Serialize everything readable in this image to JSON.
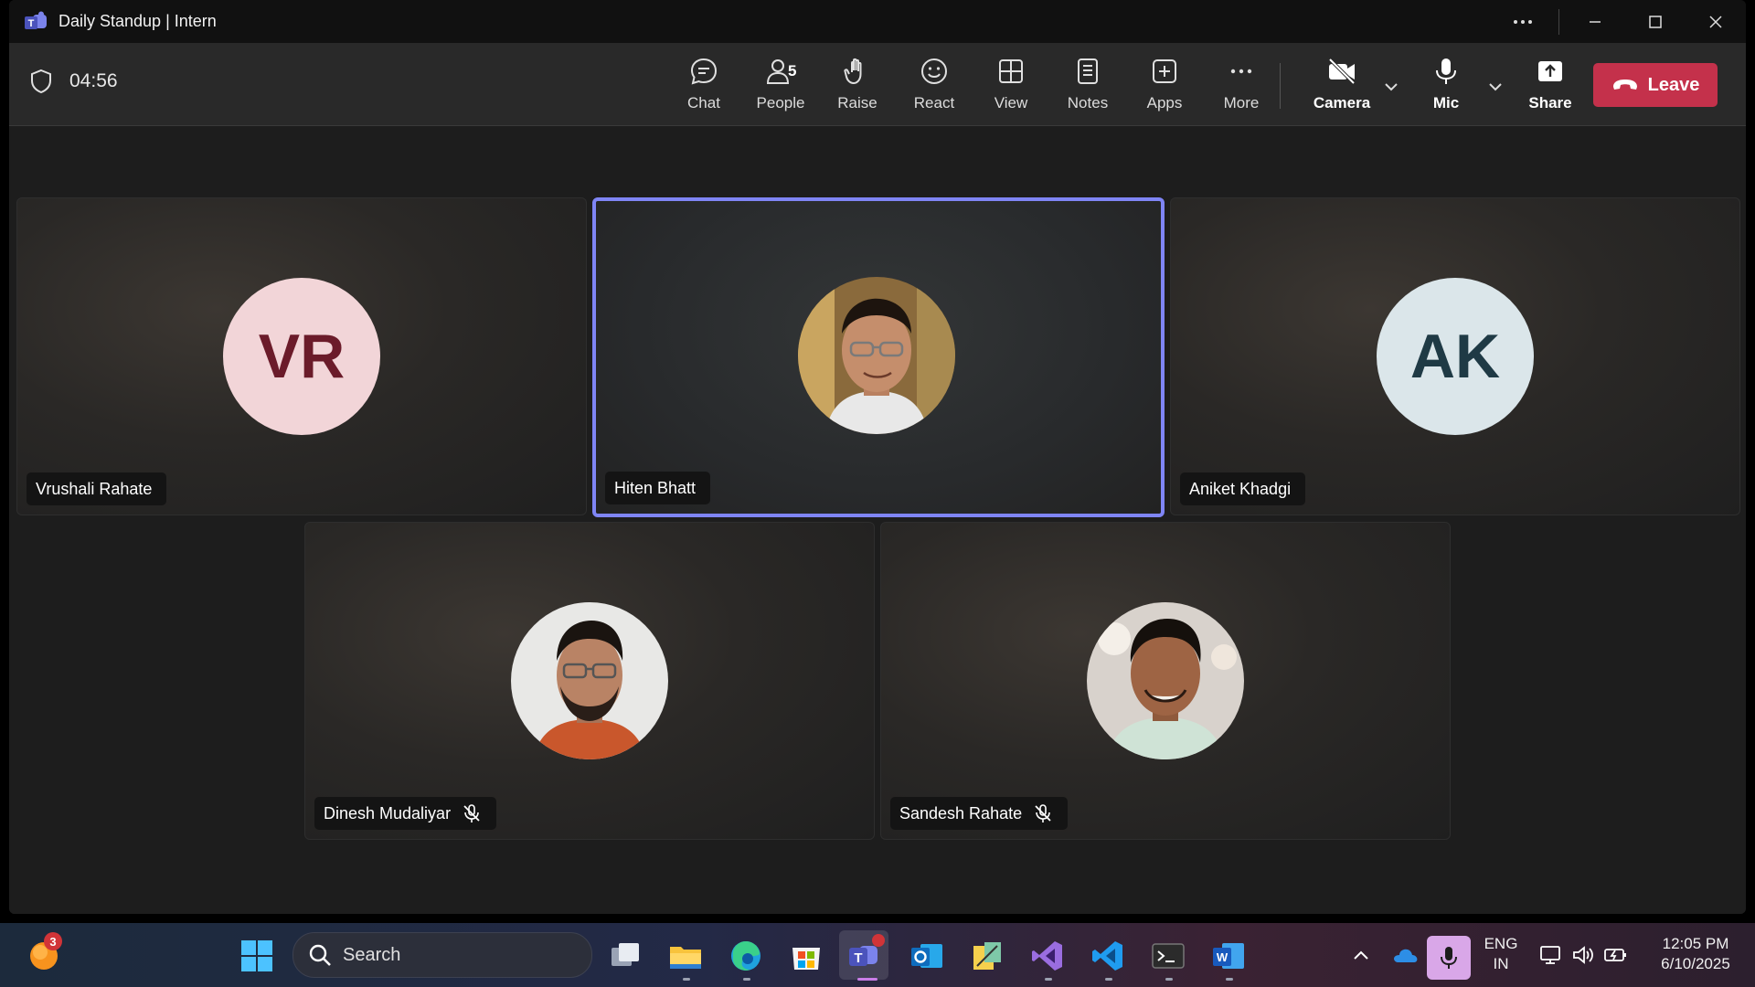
{
  "window": {
    "title": "Daily Standup | Intern",
    "controls": [
      "more",
      "minimize",
      "maximize",
      "close"
    ]
  },
  "toolbar": {
    "timer": "04:56",
    "people_count": "5",
    "tools": {
      "chat": "Chat",
      "people": "People",
      "raise": "Raise",
      "react": "React",
      "view": "View",
      "notes": "Notes",
      "apps": "Apps",
      "more": "More",
      "camera": "Camera",
      "mic": "Mic",
      "share": "Share"
    },
    "leave_label": "Leave"
  },
  "participants": [
    {
      "name": "Vrushali Rahate",
      "initials": "VR",
      "muted": false,
      "active": false,
      "avatar_bg": "#f2d5d8",
      "avatar_fg": "#6b1b2a"
    },
    {
      "name": "Hiten Bhatt",
      "initials": "",
      "muted": false,
      "active": true,
      "photo": true
    },
    {
      "name": "Aniket Khadgi",
      "initials": "AK",
      "muted": false,
      "active": false,
      "avatar_bg": "#dbe6ea",
      "avatar_fg": "#1f3a45"
    },
    {
      "name": "Dinesh Mudaliyar",
      "initials": "",
      "muted": true,
      "active": false,
      "photo": true
    },
    {
      "name": "Sandesh Rahate",
      "initials": "",
      "muted": true,
      "active": false,
      "photo": true
    }
  ],
  "taskbar": {
    "notification_badge": "3",
    "search_label": "Search",
    "language_line1": "ENG",
    "language_line2": "IN",
    "time": "12:05 PM",
    "date": "6/10/2025"
  },
  "colors": {
    "leave": "#c4314b",
    "active_speaker": "#7f85f5",
    "teams": "#6264a7"
  }
}
